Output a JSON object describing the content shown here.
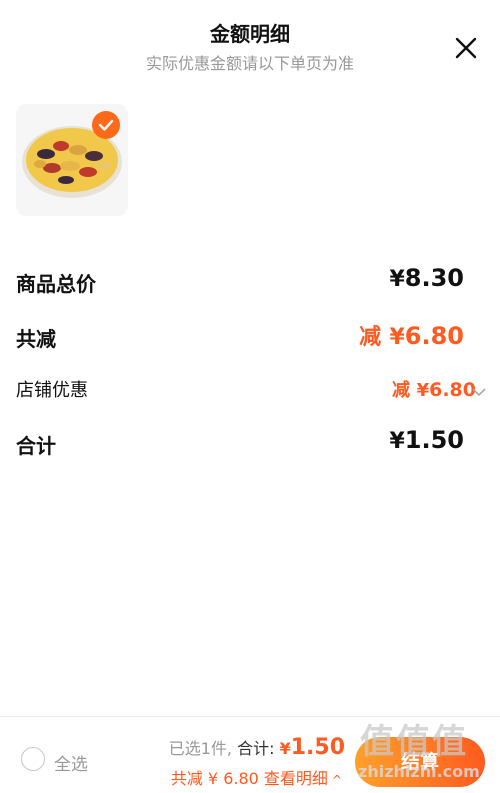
{
  "header": {
    "title": "金额明细",
    "subtitle": "实际优惠金额请以下单页为准",
    "close_icon": "close-icon"
  },
  "product": {
    "image": "mixed raisins in a bowl",
    "selected": true
  },
  "breakdown": {
    "goods_total": {
      "label": "商品总价",
      "symbol": "¥",
      "value": "8.30"
    },
    "total_reduction": {
      "label": "共减",
      "prefix": "减",
      "symbol": "¥",
      "value": "6.80"
    },
    "shop_discount": {
      "label": "店铺优惠",
      "prefix": "减",
      "symbol": "¥",
      "value": "6.80"
    },
    "grand_total": {
      "label": "合计",
      "symbol": "¥",
      "value": "1.50"
    }
  },
  "footer": {
    "select_all_label": "全选",
    "selected_count_text": "已选1件,",
    "total_label": "合计:",
    "total_symbol": "¥",
    "total_value": "1.50",
    "savings_text": "共减 ¥ 6.80",
    "details_link": "查看明细",
    "checkout_label": "结算"
  },
  "watermark": {
    "glyphs": "值值值",
    "site": "zhizhizhi.com"
  },
  "colors": {
    "accent": "#ff5a1f",
    "checkout_gradient_start": "#ffa12b",
    "checkout_gradient_end": "#ff5a1f",
    "muted_text": "#999999"
  }
}
